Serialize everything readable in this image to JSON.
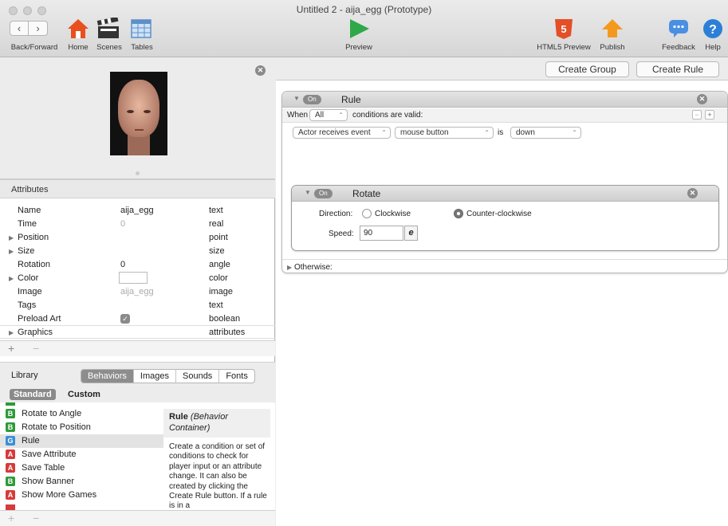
{
  "window": {
    "title": "Untitled 2 - aija_egg (Prototype)"
  },
  "toolbar": {
    "back_forward": "Back/Forward",
    "home": "Home",
    "scenes": "Scenes",
    "tables": "Tables",
    "preview": "Preview",
    "html5_preview": "HTML5 Preview",
    "publish": "Publish",
    "feedback": "Feedback",
    "help": "Help"
  },
  "attributes": {
    "header": "Attributes",
    "rows": [
      {
        "name": "Name",
        "value": "aija_egg",
        "type": "text"
      },
      {
        "name": "Time",
        "value": "0",
        "type": "real"
      },
      {
        "name": "Position",
        "value": "",
        "type": "point"
      },
      {
        "name": "Size",
        "value": "",
        "type": "size"
      },
      {
        "name": "Rotation",
        "value": "0",
        "type": "angle"
      },
      {
        "name": "Color",
        "value": "",
        "type": "color"
      },
      {
        "name": "Image",
        "value": "aija_egg",
        "type": "image"
      },
      {
        "name": "Tags",
        "value": "",
        "type": "text"
      },
      {
        "name": "Preload Art",
        "value": "",
        "type": "boolean"
      },
      {
        "name": "Graphics",
        "value": "",
        "type": "attributes"
      }
    ]
  },
  "library": {
    "label": "Library",
    "tabs": [
      "Behaviors",
      "Images",
      "Sounds",
      "Fonts"
    ],
    "subtabs": [
      "Standard",
      "Custom"
    ],
    "items": [
      {
        "badge": "B",
        "label": "Rotate to Angle",
        "color": "#2e9a3a"
      },
      {
        "badge": "B",
        "label": "Rotate to Position",
        "color": "#2e9a3a"
      },
      {
        "badge": "G",
        "label": "Rule",
        "color": "#3a8fd6"
      },
      {
        "badge": "A",
        "label": "Save Attribute",
        "color": "#d63a3a"
      },
      {
        "badge": "A",
        "label": "Save Table",
        "color": "#d63a3a"
      },
      {
        "badge": "B",
        "label": "Show Banner",
        "color": "#2e9a3a"
      },
      {
        "badge": "A",
        "label": "Show More Games",
        "color": "#d63a3a"
      }
    ],
    "description": {
      "title": "Rule",
      "subtitle": "(Behavior Container)",
      "body": "Create a condition or set of conditions to check for player input or an attribute change. It can also be created by clicking the Create Rule button. If a rule is in a"
    }
  },
  "rules_panel": {
    "create_group": "Create Group",
    "create_rule": "Create Rule",
    "rule": {
      "on_label": "On",
      "title": "Rule",
      "when": "When",
      "all": "All",
      "conditions_text": "conditions are valid:",
      "condition": {
        "subject": "Actor receives event",
        "event": "mouse button",
        "is": "is",
        "state": "down"
      }
    },
    "rotate": {
      "on_label": "On",
      "title": "Rotate",
      "direction_label": "Direction:",
      "clockwise": "Clockwise",
      "counter_clockwise": "Counter-clockwise",
      "speed_label": "Speed:",
      "speed_value": "90",
      "expr_symbol": "e"
    },
    "otherwise": "Otherwise:"
  }
}
